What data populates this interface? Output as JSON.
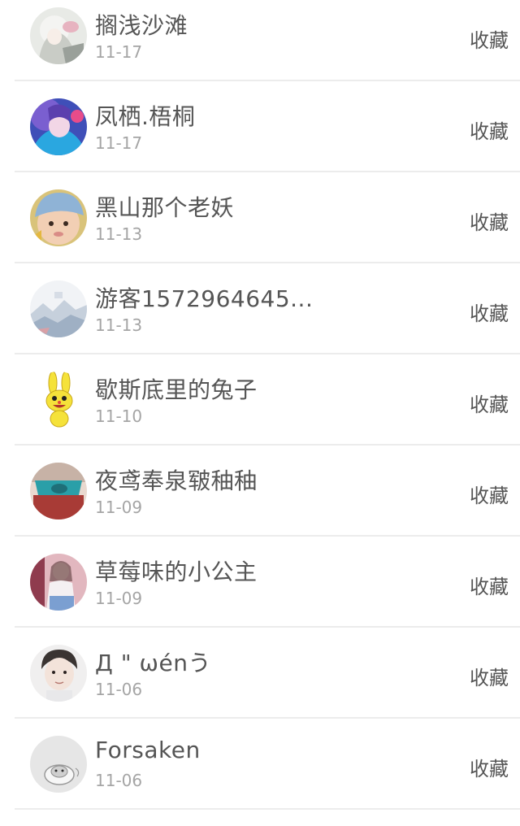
{
  "items": [
    {
      "name": "搁浅沙滩",
      "date": "11-17",
      "action": "收藏",
      "avatar": "avatar-anime-girl-white-hair"
    },
    {
      "name": "凤栖.梧桐",
      "date": "11-17",
      "action": "收藏",
      "avatar": "avatar-anime-girl-blue-hair"
    },
    {
      "name": "黑山那个老妖",
      "date": "11-13",
      "action": "收藏",
      "avatar": "avatar-baby-with-hat"
    },
    {
      "name": "游客1572964645...",
      "date": "11-13",
      "action": "收藏",
      "avatar": "avatar-landscape-painting"
    },
    {
      "name": "歇斯底里的兔子",
      "date": "11-10",
      "action": "收藏",
      "avatar": "avatar-yellow-cartoon-rabbit"
    },
    {
      "name": "夜鸢奉泉皲秞秞",
      "date": "11-09",
      "action": "收藏",
      "avatar": "avatar-teal-bed-scene"
    },
    {
      "name": "草莓味的小公主",
      "date": "11-09",
      "action": "收藏",
      "avatar": "avatar-girl-pink-room"
    },
    {
      "name": "Д \" ωénう",
      "date": "11-06",
      "action": "收藏",
      "avatar": "avatar-boy-photo"
    },
    {
      "name": "Forsaken",
      "date": "11-06",
      "action": "收藏",
      "avatar": "avatar-grey-cartoon"
    }
  ]
}
